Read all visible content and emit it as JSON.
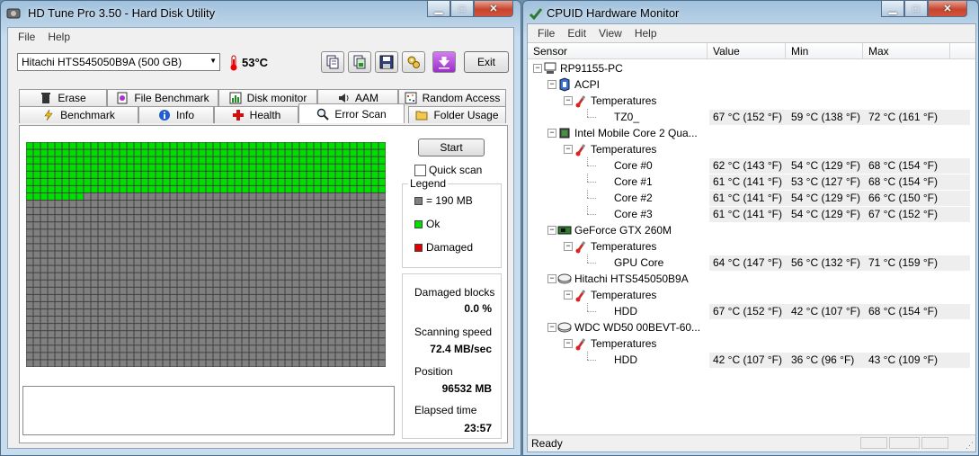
{
  "hdtune": {
    "title": "HD Tune Pro 3.50 - Hard Disk Utility",
    "menu": [
      "File",
      "Help"
    ],
    "drive": "Hitachi HTS545050B9A (500 GB)",
    "temperature": "53°C",
    "exit_label": "Exit",
    "tabs_row1": [
      "Erase",
      "File Benchmark",
      "Disk monitor",
      "AAM",
      "Random Access"
    ],
    "tabs_row2": [
      "Benchmark",
      "Info",
      "Health",
      "Error Scan",
      "Folder Usage"
    ],
    "active_tab": "Error Scan",
    "start_label": "Start",
    "quick_scan_label": "Quick scan",
    "quick_scan_checked": false,
    "legend": {
      "title": "Legend",
      "block_size": "= 190 MB",
      "ok": "Ok",
      "damaged": "Damaged"
    },
    "stats": {
      "damaged_blocks_label": "Damaged blocks",
      "damaged_blocks_value": "0.0 %",
      "scanning_speed_label": "Scanning speed",
      "scanning_speed_value": "72.4 MB/sec",
      "position_label": "Position",
      "position_value": "96532 MB",
      "elapsed_label": "Elapsed time",
      "elapsed_value": "23:57"
    },
    "scan": {
      "columns": 50,
      "rows": 31,
      "scanned_blocks": 358
    },
    "colors": {
      "ok": "#00e000",
      "unscanned": "#808080",
      "damaged": "#e00000"
    }
  },
  "cpuid": {
    "title": "CPUID Hardware Monitor",
    "menu": [
      "File",
      "Edit",
      "View",
      "Help"
    ],
    "columns": [
      "Sensor",
      "Value",
      "Min",
      "Max"
    ],
    "tree": [
      {
        "level": 0,
        "icon": "computer-icon",
        "label": "RP91155-PC"
      },
      {
        "level": 1,
        "icon": "acpi-icon",
        "label": "ACPI"
      },
      {
        "level": 2,
        "icon": "thermometer-icon",
        "label": "Temperatures"
      },
      {
        "level": 3,
        "label": "TZ0_",
        "value": "67 °C  (152 °F)",
        "min": "59 °C  (138 °F)",
        "max": "72 °C  (161 °F)"
      },
      {
        "level": 1,
        "icon": "cpu-icon",
        "label": "Intel Mobile Core 2 Qua..."
      },
      {
        "level": 2,
        "icon": "thermometer-icon",
        "label": "Temperatures"
      },
      {
        "level": 3,
        "label": "Core #0",
        "value": "62 °C  (143 °F)",
        "min": "54 °C  (129 °F)",
        "max": "68 °C  (154 °F)"
      },
      {
        "level": 3,
        "label": "Core #1",
        "value": "61 °C  (141 °F)",
        "min": "53 °C  (127 °F)",
        "max": "68 °C  (154 °F)"
      },
      {
        "level": 3,
        "label": "Core #2",
        "value": "61 °C  (141 °F)",
        "min": "54 °C  (129 °F)",
        "max": "66 °C  (150 °F)"
      },
      {
        "level": 3,
        "label": "Core #3",
        "value": "61 °C  (141 °F)",
        "min": "54 °C  (129 °F)",
        "max": "67 °C  (152 °F)"
      },
      {
        "level": 1,
        "icon": "gpu-icon",
        "label": "GeForce GTX 260M"
      },
      {
        "level": 2,
        "icon": "thermometer-icon",
        "label": "Temperatures"
      },
      {
        "level": 3,
        "label": "GPU Core",
        "value": "64 °C  (147 °F)",
        "min": "56 °C  (132 °F)",
        "max": "71 °C  (159 °F)"
      },
      {
        "level": 1,
        "icon": "disk-icon",
        "label": "Hitachi HTS545050B9A"
      },
      {
        "level": 2,
        "icon": "thermometer-icon",
        "label": "Temperatures"
      },
      {
        "level": 3,
        "label": "HDD",
        "value": "67 °C  (152 °F)",
        "min": "42 °C  (107 °F)",
        "max": "68 °C  (154 °F)"
      },
      {
        "level": 1,
        "icon": "disk-icon",
        "label": "WDC WD50 00BEVT-60..."
      },
      {
        "level": 2,
        "icon": "thermometer-icon",
        "label": "Temperatures"
      },
      {
        "level": 3,
        "label": "HDD",
        "value": "42 °C  (107 °F)",
        "min": "36 °C  (96 °F)",
        "max": "43 °C  (109 °F)"
      }
    ],
    "status": "Ready"
  }
}
